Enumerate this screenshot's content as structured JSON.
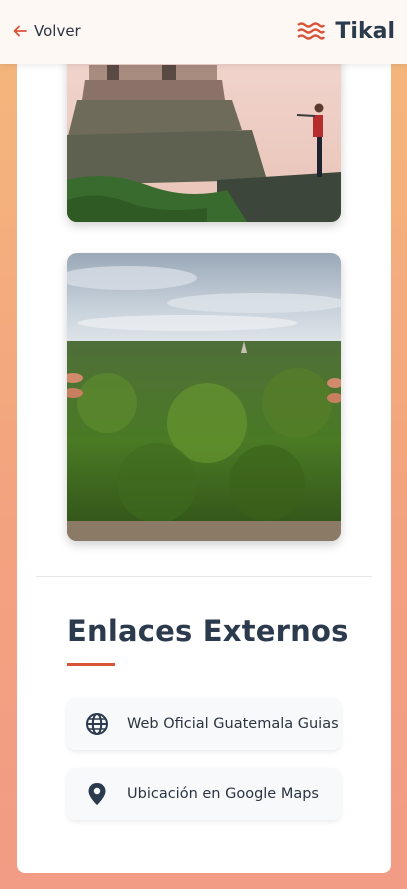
{
  "header": {
    "back_label": "Volver",
    "brand_name": "Tikal",
    "back_icon": "arrow-left-icon",
    "brand_icon": "waves-icon",
    "accent_color": "#d9533a"
  },
  "gallery": {
    "images": [
      {
        "description_icon": "temple-photo"
      },
      {
        "description_icon": "jungle-canopy-photo"
      }
    ]
  },
  "links_section": {
    "title": "Enlaces Externos",
    "items": [
      {
        "label": "Web Oficial Guatemala Guias",
        "icon": "globe-icon"
      },
      {
        "label": "Ubicación en Google Maps",
        "icon": "map-pin-icon"
      }
    ]
  }
}
